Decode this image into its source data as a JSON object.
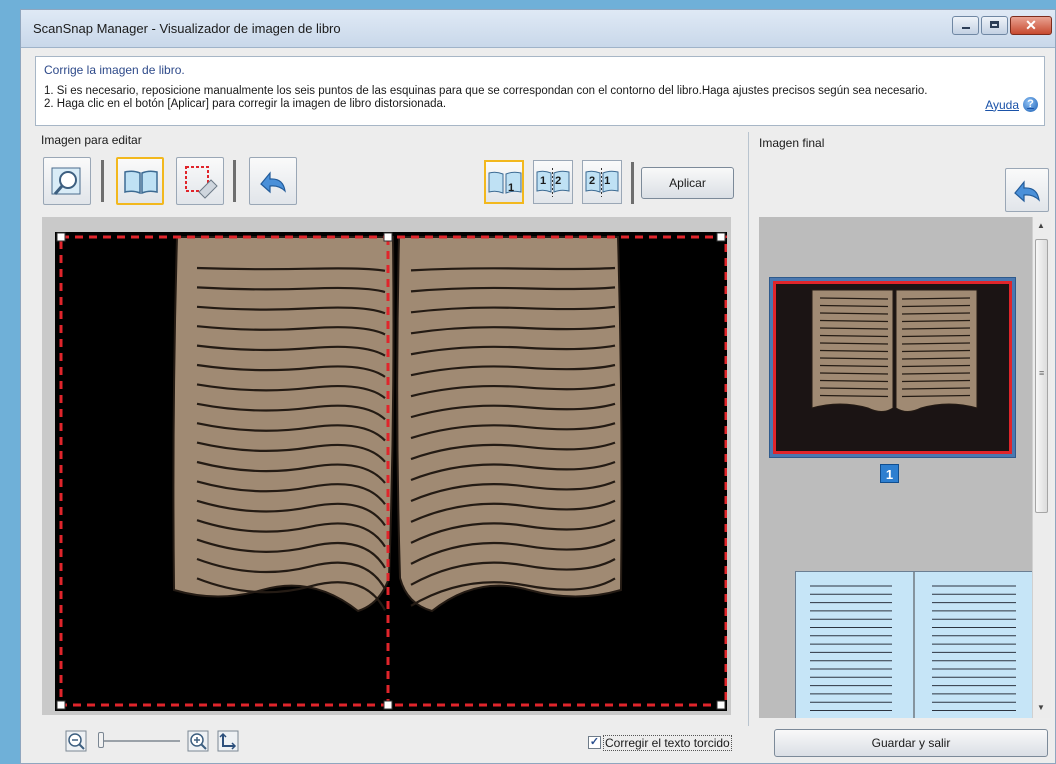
{
  "window": {
    "title": "ScanSnap Manager - Visualizador de imagen de libro",
    "controls": [
      "minimize-icon",
      "maximize-icon",
      "close-icon"
    ]
  },
  "instructions": {
    "heading": "Corrige la imagen de libro.",
    "step1": "1. Si es necesario, reposicione manualmente los seis puntos de las esquinas para que se correspondan con el contorno del libro.Haga ajustes precisos según sea necesario.",
    "step2": "2. Haga clic en el botón [Aplicar] para corregir la imagen de libro distorsionada.",
    "help_label": "Ayuda",
    "help_icon": "question-icon"
  },
  "editor": {
    "label": "Imagen para editar",
    "tools": [
      "magnifier-tool-icon",
      "book-correction-tool-icon",
      "eraser-tool-icon",
      "undo-icon"
    ],
    "modes": [
      {
        "name": "single-page",
        "label": "1",
        "selected": true
      },
      {
        "name": "two-pages-left-right",
        "label": "1 2",
        "selected": false
      },
      {
        "name": "two-pages-right-left",
        "label": "2 1",
        "selected": false
      }
    ],
    "apply_label": "Aplicar"
  },
  "final": {
    "label": "Imagen final",
    "undo_icon": "undo-icon",
    "page_number": "1"
  },
  "bottom": {
    "zoom_out_icon": "zoom-out-icon",
    "zoom_in_icon": "zoom-in-icon",
    "fit_icon": "fit-to-window-icon",
    "deskew_label": "Corregir el texto torcido",
    "deskew_checked": true,
    "save_label": "Guardar y salir"
  },
  "colors": {
    "selection_border": "#f2b81e",
    "guide_line": "#e0252b",
    "page_color": "#a08a73",
    "preview_page_color": "#c6e5f7"
  }
}
